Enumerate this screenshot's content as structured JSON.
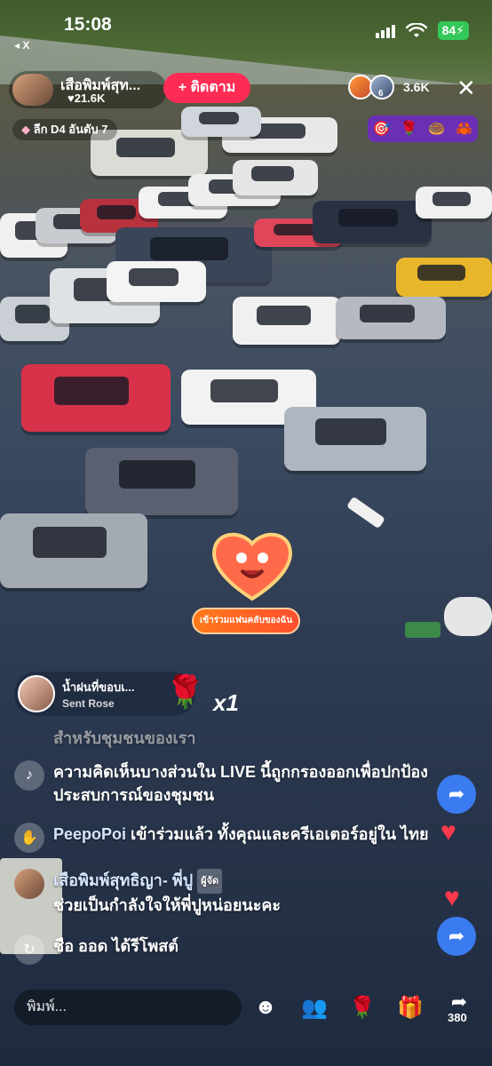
{
  "status_bar": {
    "time": "15:08",
    "back_label": "◂ X",
    "battery": "84"
  },
  "host": {
    "name": "เสือพิมพ์สุท...",
    "likes": "21.6K",
    "follow_label": "+ ติดตาม",
    "league_label": "ลีก D4 อันดับ 7"
  },
  "viewers": {
    "count": "3.6K",
    "second_rank": "6"
  },
  "gift_rank_icons": [
    "🎯",
    "🌹",
    "🍩",
    "🦀"
  ],
  "promo": {
    "banner": "เข้าร่วมแฟนคลับของฉัน"
  },
  "gift_notice": {
    "sender": "น้ำฝนที่ขอบเ...",
    "action": "Sent Rose",
    "multiplier": "x1"
  },
  "comments": {
    "faded": "สำหรับชุมชนของเรา",
    "filter_notice": "ความคิดเห็นบางส่วนใน LIVE นี้ถูกกรองออกเพื่อปกป้องประสบการณ์ของชุมชน",
    "join_user": "PeepoPoi",
    "join_text": " เข้าร่วมแล้ว ทั้งคุณและครีเอเตอร์อยู่ใน ไทย",
    "host_user": "เสือพิมพ์สุทธิญา- พี่ปู",
    "host_badge": "ผู้จัด",
    "host_text": "ช่วยเป็นกำลังใจให้พี่ปูหน่อยนะคะ",
    "repost_text": "ชือ ออด ได้รีโพสต์"
  },
  "bottom": {
    "input_placeholder": "พิมพ์...",
    "share_count": "380"
  },
  "colors": {
    "accent": "#fe2c55",
    "share_blue": "#3b7bf0",
    "battery_green": "#34c759"
  }
}
